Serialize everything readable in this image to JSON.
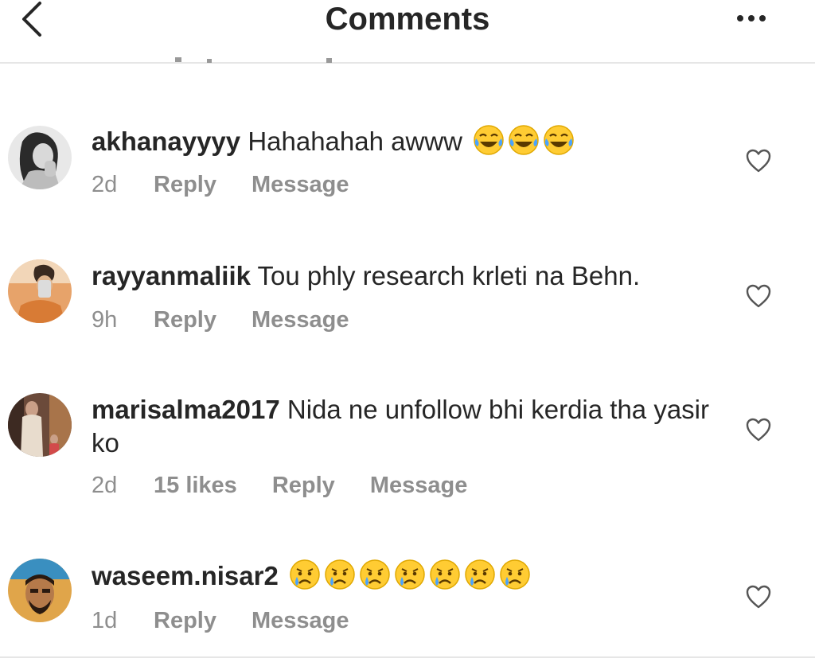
{
  "header": {
    "title": "Comments",
    "back_icon": "chevron-left-icon",
    "more_icon": "ellipsis-icon"
  },
  "comments": [
    {
      "username": "akhanayyyy",
      "text": "Hahahahah awww",
      "emojis": [
        "laughing-crying-emoji",
        "laughing-crying-emoji",
        "laughing-crying-emoji"
      ],
      "time": "2d",
      "likes": "",
      "reply": "Reply",
      "message": "Message"
    },
    {
      "username": "rayyanmaliik",
      "text": "Tou phly research krleti na Behn.",
      "emojis": [],
      "time": "9h",
      "likes": "",
      "reply": "Reply",
      "message": "Message"
    },
    {
      "username": "marisalma2017",
      "text": "Nida ne unfollow bhi kerdia tha yasir ko",
      "emojis": [],
      "time": "2d",
      "likes": "15 likes",
      "reply": "Reply",
      "message": "Message"
    },
    {
      "username": "waseem.nisar2",
      "text": "",
      "emojis": [
        "crying-emoji",
        "crying-emoji",
        "crying-emoji",
        "crying-emoji",
        "crying-emoji",
        "crying-emoji",
        "crying-emoji"
      ],
      "time": "1d",
      "likes": "",
      "reply": "Reply",
      "message": "Message"
    }
  ],
  "colors": {
    "text": "#262626",
    "secondary": "#8e8e8e",
    "divider": "#e6e6e6",
    "emoji_face": "#ffcc33"
  }
}
